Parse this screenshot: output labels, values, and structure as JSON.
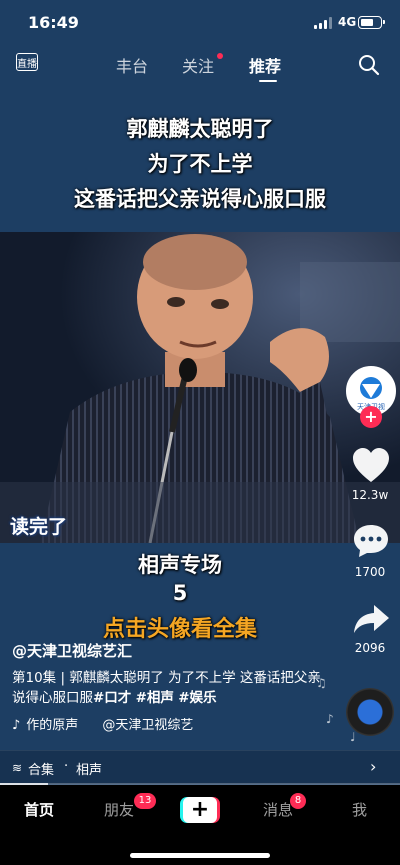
{
  "status_bar": {
    "time": "16:49",
    "network": "4G",
    "battery_level": 0.7
  },
  "top_nav": {
    "live_label": "直播",
    "tabs": [
      {
        "label": "丰台",
        "active": false
      },
      {
        "label": "关注",
        "active": false,
        "has_dot": true
      },
      {
        "label": "推荐",
        "active": true
      }
    ],
    "search_icon": "search-icon"
  },
  "video": {
    "headline": [
      "郭麒麟太聪明了",
      "为了不上学",
      "这番话把父亲说得心服口服"
    ],
    "caption": "读完了",
    "overlay_lines": [
      "相声专场",
      "5",
      "点击头像看全集"
    ]
  },
  "right_rail": {
    "avatar_label": "天津卫视",
    "likes": "12.3w",
    "comments": "1700",
    "shares": "2096"
  },
  "post": {
    "author": "@天津卫视综艺汇",
    "description": "第10集 | 郭麒麟太聪明了 为了不上学 这番话把父亲说得心服口服",
    "tags": [
      "#口才",
      "#相声",
      "#娱乐"
    ],
    "music_left": "作的原声",
    "music_right": "@天津卫视综艺"
  },
  "collection": {
    "label": "合集",
    "topic": "相声",
    "progress": 0.12
  },
  "tab_bar": {
    "tabs": [
      {
        "label": "首页",
        "active": true
      },
      {
        "label": "朋友",
        "badge": "13"
      },
      {
        "label": "消息",
        "badge": "8"
      },
      {
        "label": "我"
      }
    ],
    "create_label": "+"
  },
  "colors": {
    "accent_red": "#fe2c55",
    "accent_cyan": "#25f4ee",
    "overlay_orange": "#f5a623",
    "background_blue": "#1d3e63"
  }
}
